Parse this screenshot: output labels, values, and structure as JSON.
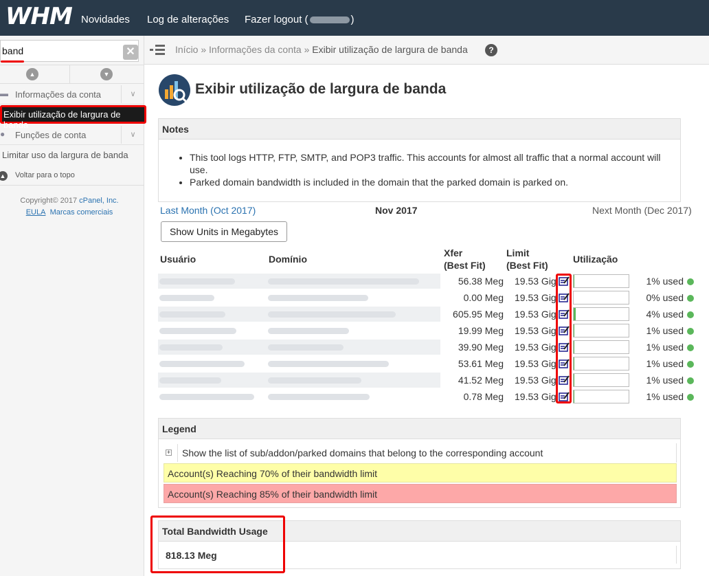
{
  "topbar": {
    "logo": "WHM",
    "nav": [
      "Novidades",
      "Log de alterações"
    ],
    "logout_prefix": "Fazer logout (",
    "logout_suffix": ")"
  },
  "sidebar": {
    "search_value": "band",
    "categories": [
      {
        "label": "Informações da conta",
        "icon": "account-info-icon"
      },
      {
        "label": "Funções de conta",
        "icon": "account-functions-icon"
      }
    ],
    "active_item": "Exibir utilização de largura de banda",
    "item_limit": "Limitar uso da largura de banda",
    "back_to_top": "Voltar para o topo",
    "copyright_prefix": "Copyright© 2017 ",
    "copyright_company": "cPanel, Inc.",
    "eula": "EULA",
    "trademarks": "Marcas comerciais"
  },
  "breadcrumb": {
    "home": "Início",
    "sep": "»",
    "section": "Informações da conta",
    "current": "Exibir utilização de largura de banda"
  },
  "page": {
    "title": "Exibir utilização de largura de banda"
  },
  "notes": {
    "heading": "Notes",
    "items": [
      "This tool logs HTTP, FTP, SMTP, and POP3 traffic. This accounts for almost all traffic that a normal account will use.",
      "Parked domain bandwidth is included in the domain that the parked domain is parked on."
    ]
  },
  "month_nav": {
    "prev": "Last Month (Oct 2017)",
    "current": "Nov 2017",
    "next": "Next Month (Dec 2017)"
  },
  "units_button": "Show Units in Megabytes",
  "table": {
    "headers": {
      "user": "Usuário",
      "domain": "Domínio",
      "xfer_1": "Xfer",
      "xfer_2": "(Best Fit)",
      "limit_1": "Limit",
      "limit_2": "(Best Fit)",
      "util": "Utilização"
    },
    "rows": [
      {
        "xfer": "56.38 Meg",
        "limit": "19.53 Gig",
        "used": "1% used",
        "usage_pct": 1
      },
      {
        "xfer": "0.00 Meg",
        "limit": "19.53 Gig",
        "used": "0% used",
        "usage_pct": 0
      },
      {
        "xfer": "605.95 Meg",
        "limit": "19.53 Gig",
        "used": "4% used",
        "usage_pct": 4
      },
      {
        "xfer": "19.99 Meg",
        "limit": "19.53 Gig",
        "used": "1% used",
        "usage_pct": 1
      },
      {
        "xfer": "39.90 Meg",
        "limit": "19.53 Gig",
        "used": "1% used",
        "usage_pct": 1
      },
      {
        "xfer": "53.61 Meg",
        "limit": "19.53 Gig",
        "used": "1% used",
        "usage_pct": 1
      },
      {
        "xfer": "41.52 Meg",
        "limit": "19.53 Gig",
        "used": "1% used",
        "usage_pct": 1
      },
      {
        "xfer": "0.78 Meg",
        "limit": "19.53 Gig",
        "used": "1% used",
        "usage_pct": 1
      }
    ]
  },
  "legend": {
    "heading": "Legend",
    "expand_text": "Show the list of sub/addon/parked domains that belong to the corresponding account",
    "warn70": "Account(s) Reaching 70% of their bandwidth limit",
    "warn85": "Account(s) Reaching 85% of their bandwidth limit",
    "warn70_color": "#fefea8",
    "warn85_color": "#fda8a8"
  },
  "total": {
    "heading": "Total Bandwidth Usage",
    "value": "818.13 Meg"
  },
  "colors": {
    "topbar": "#293a4a",
    "link": "#2a72b0",
    "highlight": "#e00000",
    "ok": "#5bb75b"
  }
}
